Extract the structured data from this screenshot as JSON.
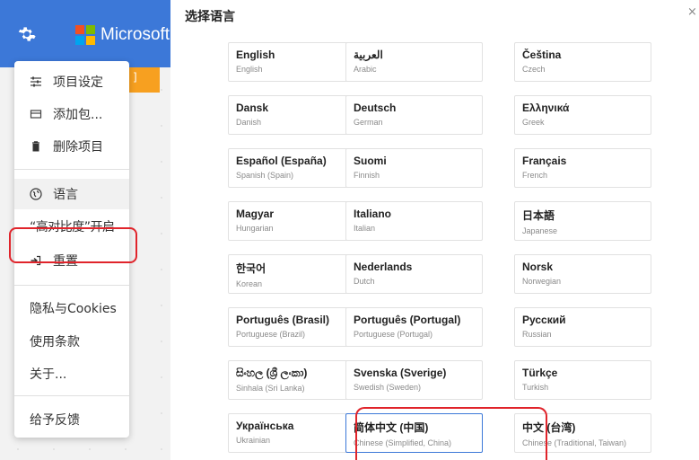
{
  "app": {
    "brand": "Microsoft",
    "orange_button_label": "]",
    "brand_colors": [
      "#f25022",
      "#7fba00",
      "#00a4ef",
      "#ffb900"
    ],
    "topbar_color": "#3c78d8"
  },
  "menu": {
    "items": [
      {
        "label": "项目设定",
        "icon": "sliders-icon"
      },
      {
        "label": "添加包...",
        "icon": "package-icon"
      },
      {
        "label": "删除项目",
        "icon": "trash-icon"
      },
      {
        "label": "语言",
        "icon": "globe-icon"
      },
      {
        "label": "“高对比度”开启",
        "icon": ""
      },
      {
        "label": "重置",
        "icon": "reset-icon"
      },
      {
        "label": "隐私与Cookies",
        "icon": ""
      },
      {
        "label": "使用条款",
        "icon": ""
      },
      {
        "label": "关于...",
        "icon": ""
      },
      {
        "label": "给予反馈",
        "icon": ""
      }
    ]
  },
  "dialog": {
    "title": "选择语言",
    "close_glyph": "×",
    "languages": [
      {
        "native": "English",
        "english": "English"
      },
      {
        "native": "العربية",
        "english": "Arabic"
      },
      {
        "native": "Čeština",
        "english": "Czech"
      },
      {
        "native": "Dansk",
        "english": "Danish"
      },
      {
        "native": "Deutsch",
        "english": "German"
      },
      {
        "native": "Ελληνικά",
        "english": "Greek"
      },
      {
        "native": "Español (España)",
        "english": "Spanish (Spain)"
      },
      {
        "native": "Suomi",
        "english": "Finnish"
      },
      {
        "native": "Français",
        "english": "French"
      },
      {
        "native": "Magyar",
        "english": "Hungarian"
      },
      {
        "native": "Italiano",
        "english": "Italian"
      },
      {
        "native": "日本語",
        "english": "Japanese"
      },
      {
        "native": "한국어",
        "english": "Korean"
      },
      {
        "native": "Nederlands",
        "english": "Dutch"
      },
      {
        "native": "Norsk",
        "english": "Norwegian"
      },
      {
        "native": "Português (Brasil)",
        "english": "Portuguese (Brazil)"
      },
      {
        "native": "Português (Portugal)",
        "english": "Portuguese (Portugal)"
      },
      {
        "native": "Русский",
        "english": "Russian"
      },
      {
        "native": "සිංහල (ශ්‍රී ලංකා)",
        "english": "Sinhala (Sri Lanka)"
      },
      {
        "native": "Svenska (Sverige)",
        "english": "Swedish (Sweden)"
      },
      {
        "native": "Türkçe",
        "english": "Turkish"
      },
      {
        "native": "Українська",
        "english": "Ukrainian"
      },
      {
        "native": "简体中文 (中国)",
        "english": "Chinese (Simplified, China)"
      },
      {
        "native": "中文 (台湾)",
        "english": "Chinese (Traditional, Taiwan)"
      }
    ],
    "selected_language": "简体中文 (中国)"
  },
  "colors": {
    "highlight": "#e0242b",
    "selected_border": "#3c78d8",
    "accent_orange": "#f7a020"
  }
}
